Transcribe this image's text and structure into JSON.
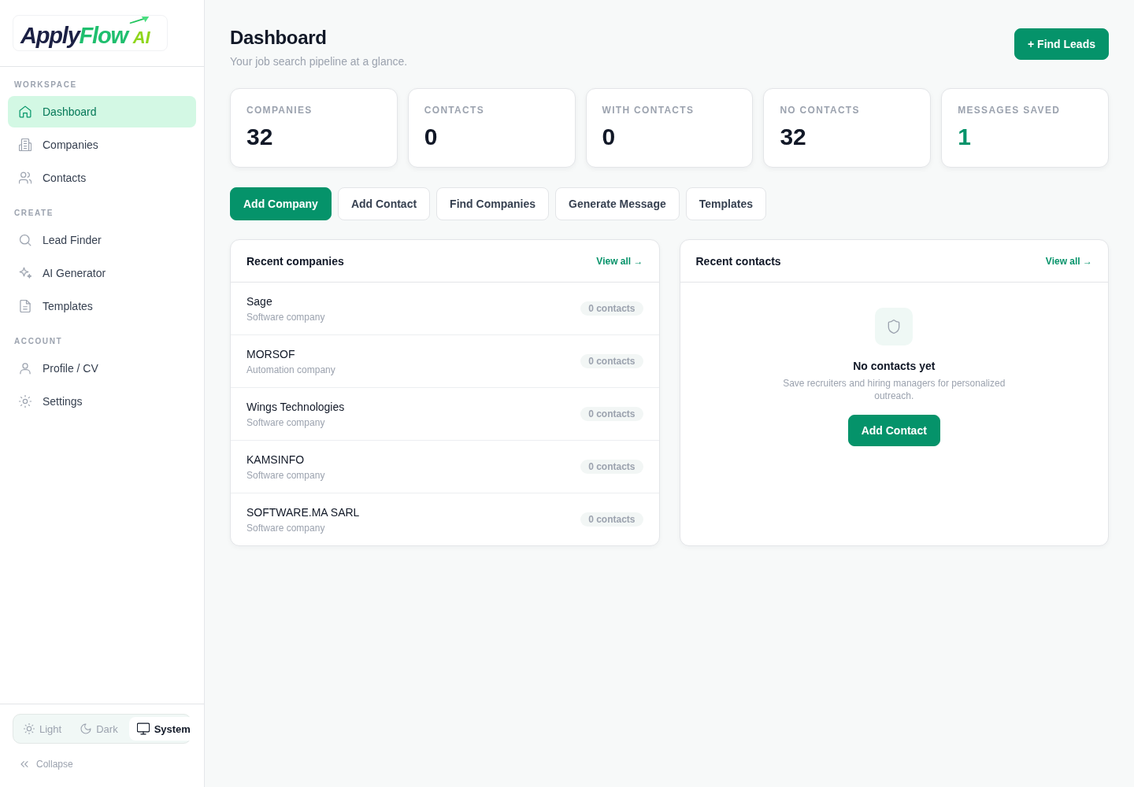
{
  "sidebar": {
    "logo": {
      "parts": [
        "Apply",
        "Flow"
      ],
      "suffix": "AI"
    },
    "sections": [
      {
        "label": "WORKSPACE",
        "items": [
          {
            "label": "Dashboard",
            "selected": true
          },
          {
            "label": "Companies",
            "selected": false
          },
          {
            "label": "Contacts",
            "selected": false
          }
        ]
      },
      {
        "label": "CREATE",
        "items": [
          {
            "label": "Lead Finder",
            "selected": false
          },
          {
            "label": "AI Generator",
            "selected": false
          },
          {
            "label": "Templates",
            "selected": false
          }
        ]
      },
      {
        "label": "ACCOUNT",
        "items": [
          {
            "label": "Profile / CV",
            "selected": false
          },
          {
            "label": "Settings",
            "selected": false
          }
        ]
      }
    ],
    "theme_switcher": {
      "options": [
        {
          "label": "Light",
          "selected": false
        },
        {
          "label": "Dark",
          "selected": false
        },
        {
          "label": "System",
          "selected": true
        }
      ]
    },
    "collapse": {
      "label": "Collapse"
    }
  },
  "header": {
    "title": "Dashboard",
    "subtitle": "Your job search pipeline at a glance.",
    "action": {
      "label": "+ Find Leads"
    }
  },
  "stats": [
    {
      "label": "COMPANIES",
      "value": "32",
      "highlighted": false
    },
    {
      "label": "CONTACTS",
      "value": "0",
      "highlighted": false
    },
    {
      "label": "WITH CONTACTS",
      "value": "0",
      "highlighted": false
    },
    {
      "label": "NO CONTACTS",
      "value": "32",
      "highlighted": false
    },
    {
      "label": "MESSAGES SAVED",
      "value": "1",
      "highlighted": true
    }
  ],
  "quick_actions": [
    {
      "label": "Add Company",
      "kind": "primary"
    },
    {
      "label": "Add Contact",
      "kind": "secondary"
    },
    {
      "label": "Find Companies",
      "kind": "secondary"
    },
    {
      "label": "Generate Message",
      "kind": "secondary"
    },
    {
      "label": "Templates",
      "kind": "secondary"
    }
  ],
  "recent_companies": {
    "title": "Recent companies",
    "link": "View all →",
    "rows": [
      {
        "name": "Sage",
        "type": "Software company",
        "badge": "0 contacts"
      },
      {
        "name": "MORSOF",
        "type": "Automation company",
        "badge": "0 contacts"
      },
      {
        "name": "Wings Technologies",
        "type": "Software company",
        "badge": "0 contacts"
      },
      {
        "name": "KAMSINFO",
        "type": "Software company",
        "badge": "0 contacts"
      },
      {
        "name": "SOFTWARE.MA SARL",
        "type": "Software company",
        "badge": "0 contacts"
      }
    ]
  },
  "recent_contacts": {
    "title": "Recent contacts",
    "link": "View all →",
    "empty_state": {
      "title": "No contacts yet",
      "text": "Save recruiters and hiring managers for personalized outreach.",
      "button": "Add Contact"
    }
  }
}
